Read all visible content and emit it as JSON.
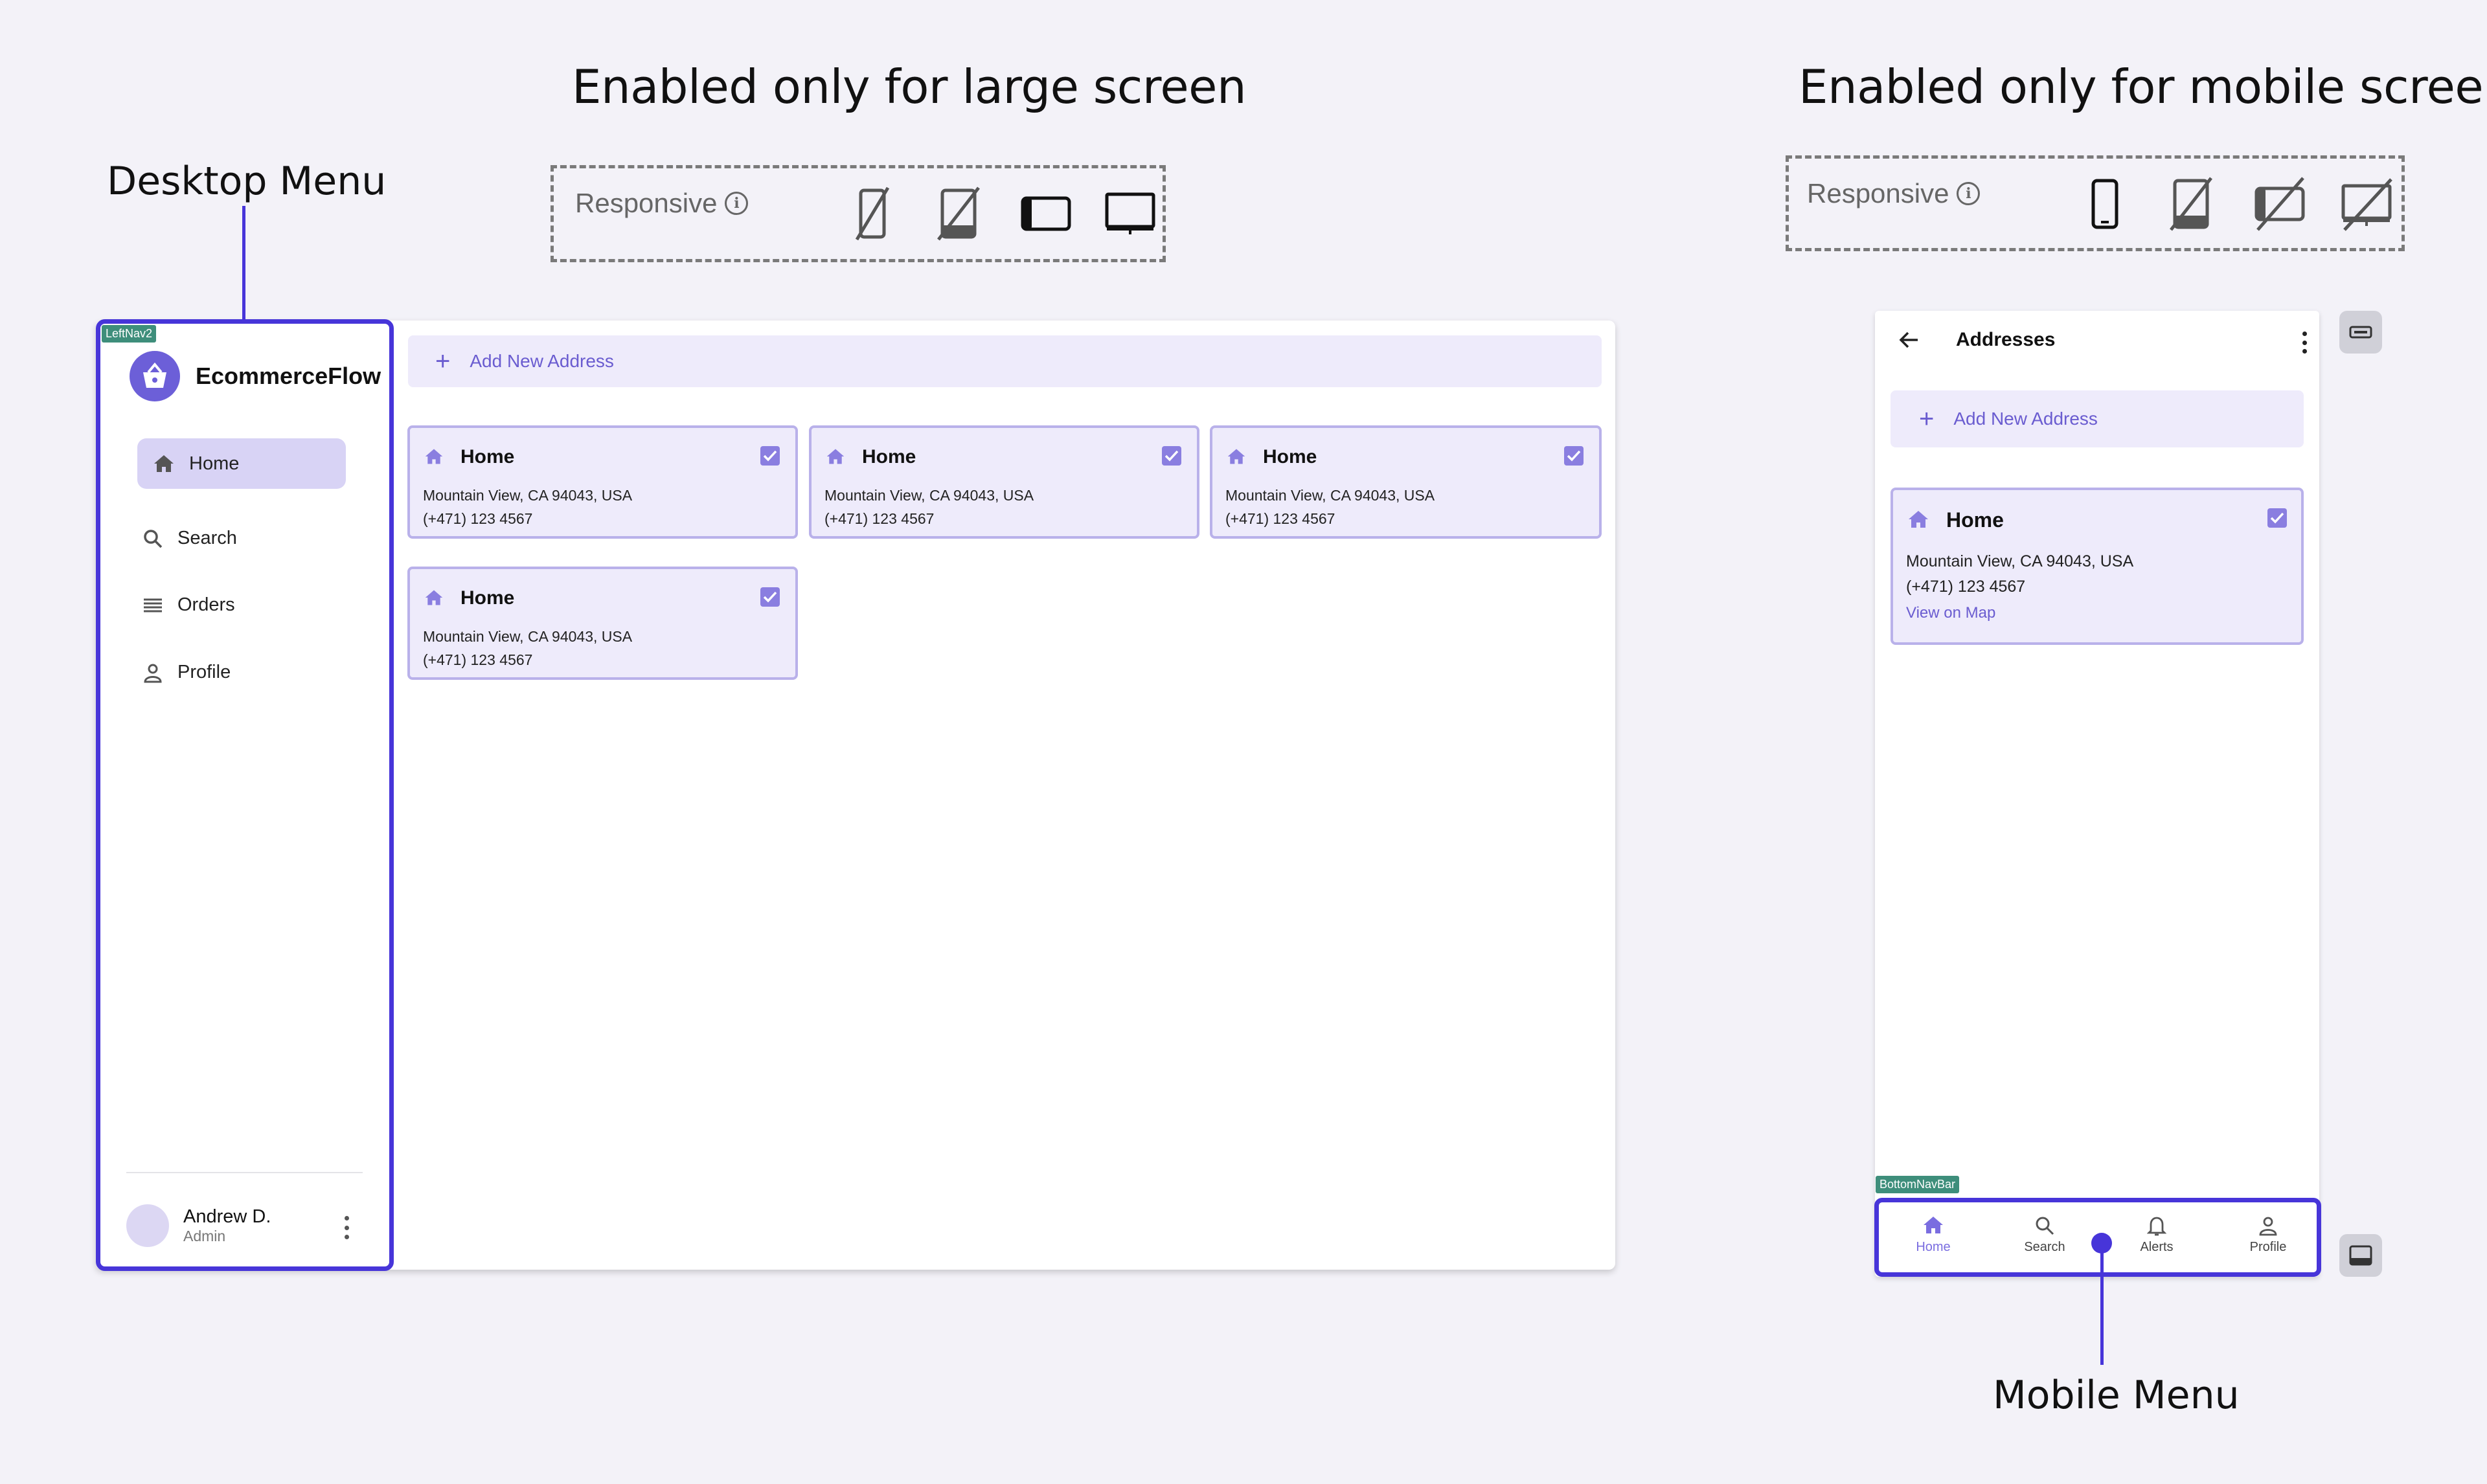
{
  "headings": {
    "large": "Enabled only for large screen",
    "mobile": "Enabled only for mobile screen"
  },
  "callouts": {
    "desktop_menu": "Desktop Menu",
    "mobile_menu": "Mobile Menu"
  },
  "responsive_label": "Responsive",
  "responsive_large": {
    "phone": "disabled",
    "tablet_portrait": "disabled",
    "tablet_landscape": "enabled",
    "desktop": "enabled"
  },
  "responsive_mobile": {
    "phone": "enabled",
    "tablet_portrait": "disabled",
    "tablet_landscape": "disabled",
    "desktop": "disabled"
  },
  "desktop": {
    "leftnav_tag": "LeftNav2",
    "brand": "EcommerceFlow",
    "nav": [
      {
        "label": "Home",
        "icon": "home-icon"
      },
      {
        "label": "Search",
        "icon": "search-icon"
      },
      {
        "label": "Orders",
        "icon": "list-icon"
      },
      {
        "label": "Profile",
        "icon": "person-icon"
      }
    ],
    "user": {
      "name": "Andrew D.",
      "role": "Admin"
    },
    "add_label": "Add New Address",
    "cards": [
      {
        "title": "Home",
        "address": "Mountain View, CA 94043, USA",
        "phone": "(+471) 123 4567"
      },
      {
        "title": "Home",
        "address": "Mountain View, CA 94043, USA",
        "phone": "(+471) 123 4567"
      },
      {
        "title": "Home",
        "address": "Mountain View, CA 94043, USA",
        "phone": "(+471) 123 4567"
      },
      {
        "title": "Home",
        "address": "Mountain View, CA 94043, USA",
        "phone": "(+471) 123 4567"
      }
    ]
  },
  "mobile": {
    "title": "Addresses",
    "add_label": "Add New Address",
    "card": {
      "title": "Home",
      "address": "Mountain View, CA 94043, USA",
      "phone": "(+471) 123 4567",
      "link": "View on Map"
    },
    "bottom_tag": "BottomNavBar",
    "bottom_nav": [
      {
        "label": "Home",
        "icon": "home-icon"
      },
      {
        "label": "Search",
        "icon": "search-icon"
      },
      {
        "label": "Alerts",
        "icon": "bell-icon"
      },
      {
        "label": "Profile",
        "icon": "person-icon"
      }
    ]
  },
  "colors": {
    "accent": "#4735d9",
    "brand": "#6c5fd8",
    "card_bg": "#eeebfb",
    "tag": "#3e8e7b",
    "page_bg": "#f3f2f8"
  }
}
